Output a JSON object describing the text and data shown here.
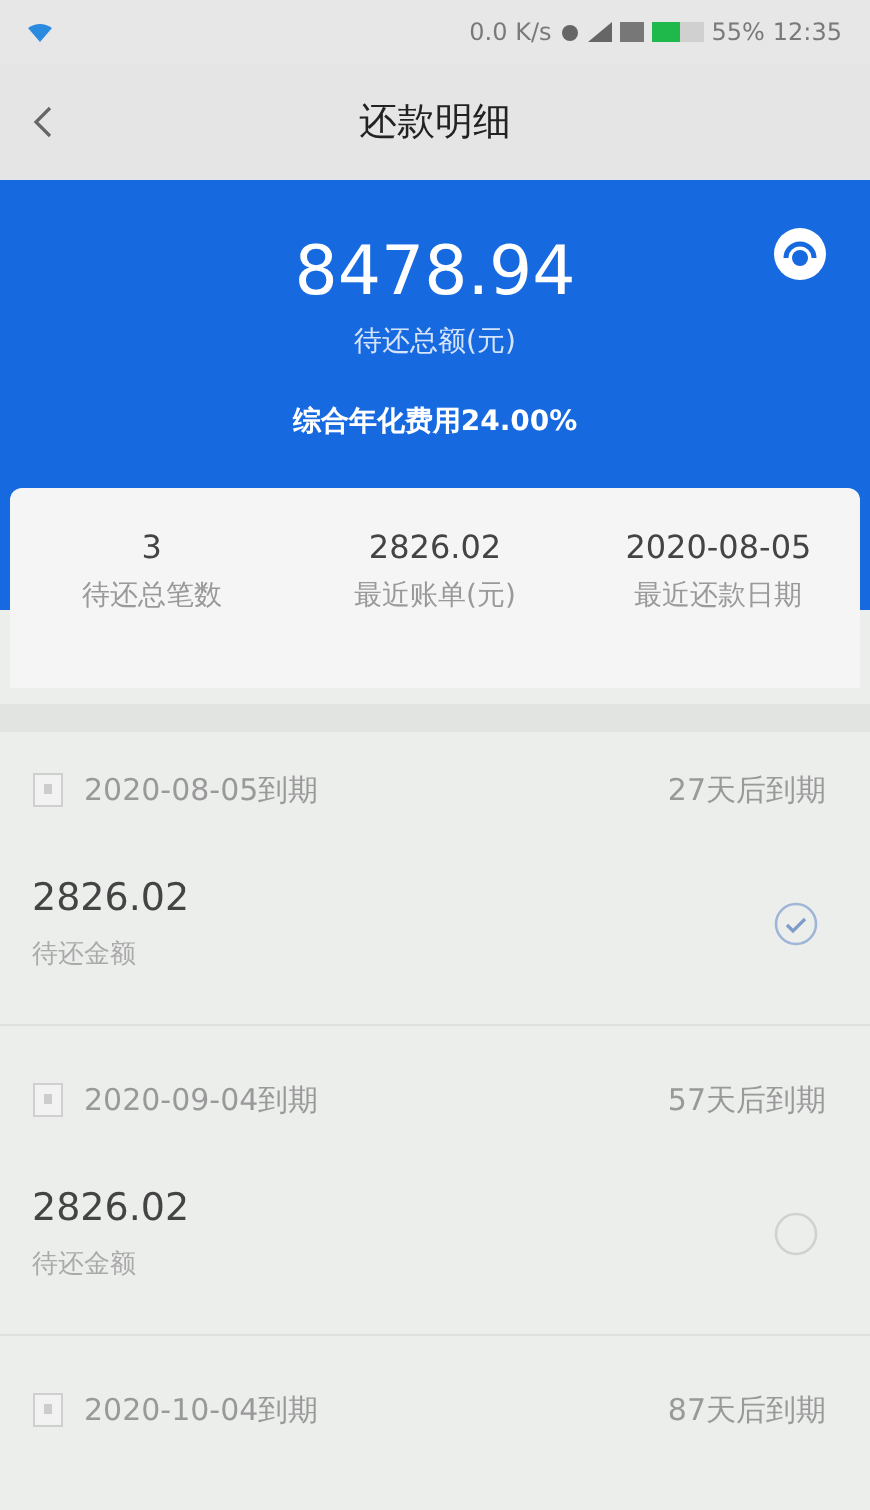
{
  "status_bar": {
    "speed": "0.0 K/s",
    "battery": "55%",
    "time": "12:35"
  },
  "nav": {
    "title": "还款明细"
  },
  "summary": {
    "total": "8478.94",
    "total_label": "待还总额(元)",
    "rate": "综合年化费用24.00%"
  },
  "stats": [
    {
      "value": "3",
      "label": "待还总笔数"
    },
    {
      "value": "2826.02",
      "label": "最近账单(元)"
    },
    {
      "value": "2020-08-05",
      "label": "最近还款日期"
    }
  ],
  "bills": [
    {
      "due": "2020-08-05到期",
      "remaining": "27天后到期",
      "amount": "2826.02",
      "amount_label": "待还金额",
      "selected": true
    },
    {
      "due": "2020-09-04到期",
      "remaining": "57天后到期",
      "amount": "2826.02",
      "amount_label": "待还金额",
      "selected": false
    },
    {
      "due": "2020-10-04到期",
      "remaining": "87天后到期"
    }
  ]
}
